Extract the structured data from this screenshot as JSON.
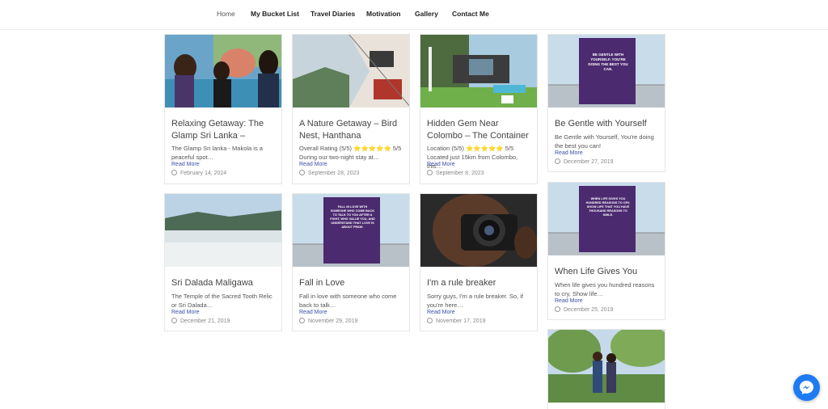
{
  "nav": {
    "items": [
      "Home",
      "My Bucket List",
      "Travel Diaries",
      "Motivation",
      "Gallery",
      "Contact Me"
    ]
  },
  "posts": [
    {
      "title": "Relaxing Getaway: The Glamp Sri Lanka –",
      "excerpt": "The Glamp Sri lanka - Makola is a peaceful spot…",
      "read_more": "Read More",
      "date": "February 14, 2024",
      "image_icon": "friends-photo"
    },
    {
      "title": "A Nature Getaway – Bird Nest, Hanthana",
      "excerpt": "Overall Rating (5/5) ⭐⭐⭐⭐⭐ 5/5 During our two-night stay at…",
      "read_more": "Read More",
      "date": "September 28, 2023",
      "image_icon": "mountain-cabin-photo"
    },
    {
      "title": "Hidden Gem Near Colombo – The Container",
      "excerpt": "Location (5/5) ⭐⭐⭐⭐⭐ 5/5 Located just 15km from Colombo, this…",
      "read_more": "Read More",
      "date": "September 8, 2023",
      "image_icon": "pool-villa-photo"
    },
    {
      "title": "Be Gentle with Yourself",
      "excerpt": "Be Gentle with Yourself, You're doing the best you can!",
      "read_more": "Read More",
      "date": "December 27, 2019",
      "image_icon": "quote-poster",
      "poster_text": "BE GENTLE WITH YOURSELF. YOU'RE DOING THE BEST YOU CAN."
    },
    {
      "title": "Sri Dalada Maligawa",
      "excerpt": "The Temple of the Sacred Tooth Relic or Sri Dalada…",
      "read_more": "Read More",
      "date": "December 21, 2019",
      "image_icon": "lake-photo"
    },
    {
      "title": "Fall in Love",
      "excerpt": "Fall in love with someone who come back to talk…",
      "read_more": "Read More",
      "date": "November 29, 2019",
      "image_icon": "quote-poster",
      "poster_text": "FALL IN LOVE WITH SOMEONE WHO COME BACK TO TALK TO YOU AFTER A FIGHT, WHO VALUE YOU, AND UNDERSTAND THAT LOVE IS ABOUT PRIDE."
    },
    {
      "title": "I'm a rule breaker",
      "excerpt": "Sorry guys, I'm a rule breaker. So, if you're here…",
      "read_more": "Read More",
      "date": "November 17, 2019",
      "image_icon": "camera-photo"
    },
    {
      "title": "When Life Gives You",
      "excerpt": "When life gives you hundred reasons to cry, Show life…",
      "read_more": "Read More",
      "date": "December 25, 2019",
      "image_icon": "quote-poster",
      "poster_text": "WHEN LIFE GIVES YOU HUNDRED REASONS TO CRY, SHOW LIFE THAT YOU HAVE THOUSAND REASONS TO SMILE."
    },
    {
      "title": "",
      "excerpt": "",
      "read_more": "",
      "date": "",
      "image_icon": "couple-photo"
    }
  ],
  "colors": {
    "accent_link": "#3a4ea8",
    "poster_purple": "#4b2a6f",
    "messenger_blue": "#1e7cf2"
  },
  "floating": {
    "icon": "messenger-icon"
  }
}
